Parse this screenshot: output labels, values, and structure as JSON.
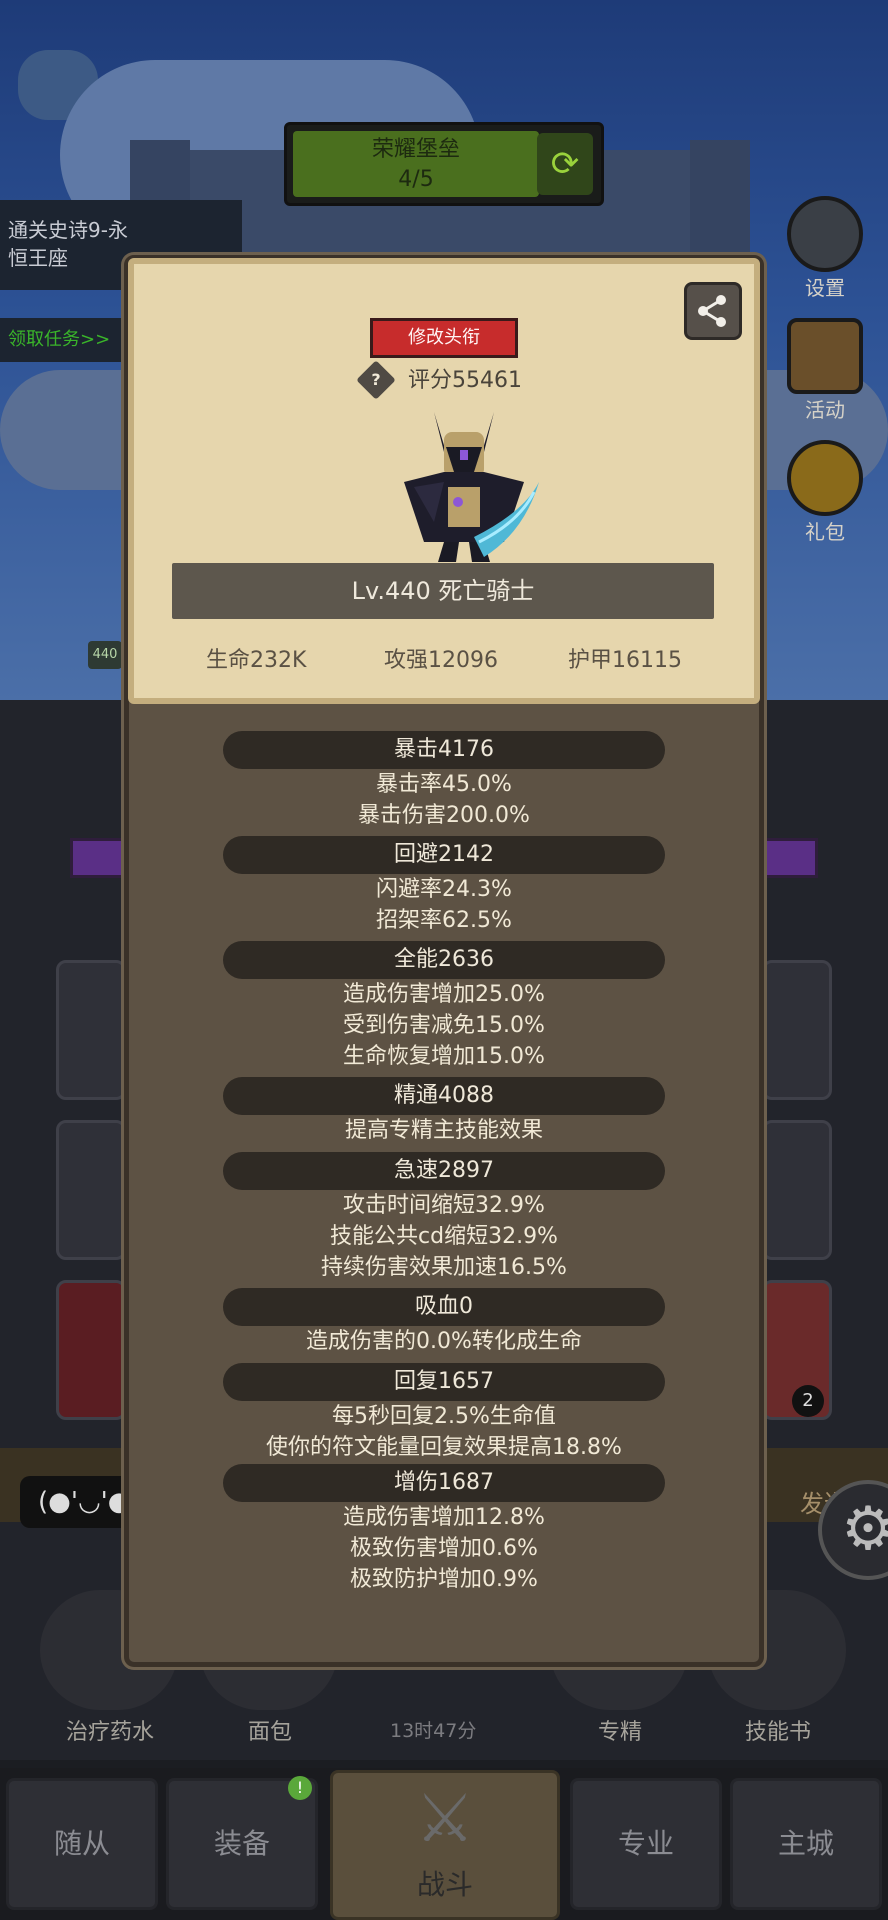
{
  "banner": {
    "title": "荣耀堡垒",
    "progress": "4/5"
  },
  "quest": {
    "line1": "通关史诗9-永",
    "line2": "恒王座",
    "claim": "领取任务>>"
  },
  "right_menu": {
    "settings": "设置",
    "activity": "活动",
    "gift": "礼包"
  },
  "scene": {
    "level_badge": "440",
    "count_badge": "2"
  },
  "chat": {
    "emoticon": "(●'◡'●",
    "send": "发送"
  },
  "actions": {
    "potion": "治疗药水",
    "bread": "面包",
    "timer": "13时47分",
    "mastery": "专精",
    "skillbook": "技能书"
  },
  "tabs": {
    "follower": "随从",
    "equipment": "装备",
    "battle": "战斗",
    "profession": "专业",
    "city": "主城",
    "notif": "!"
  },
  "card": {
    "edit_title": "修改头衔",
    "score": "评分55461",
    "score_icon": "?",
    "name": "Lv.440 死亡骑士",
    "hp": "生命232K",
    "attack": "攻强12096",
    "armor": "护甲16115"
  },
  "stats": {
    "crit": {
      "header": "暴击4176",
      "lines": [
        "暴击率45.0%",
        "暴击伤害200.0%"
      ]
    },
    "dodge": {
      "header": "回避2142",
      "lines": [
        "闪避率24.3%",
        "招架率62.5%"
      ]
    },
    "versatility": {
      "header": "全能2636",
      "lines": [
        "造成伤害增加25.0%",
        "受到伤害减免15.0%",
        "生命恢复增加15.0%"
      ]
    },
    "mastery": {
      "header": "精通4088",
      "lines": [
        "提高专精主技能效果"
      ]
    },
    "haste": {
      "header": "急速2897",
      "lines": [
        "攻击时间缩短32.9%",
        "技能公共cd缩短32.9%",
        "持续伤害效果加速16.5%"
      ]
    },
    "leech": {
      "header": "吸血0",
      "lines": [
        "造成伤害的0.0%转化成生命"
      ]
    },
    "regen": {
      "header": "回复1657",
      "lines": [
        "每5秒回复2.5%生命值",
        "使你的符文能量回复效果提高18.8%"
      ]
    },
    "dmgup": {
      "header": "增伤1687",
      "lines": [
        "造成伤害增加12.8%",
        "极致伤害增加0.6%",
        "极致防护增加0.9%"
      ]
    }
  }
}
